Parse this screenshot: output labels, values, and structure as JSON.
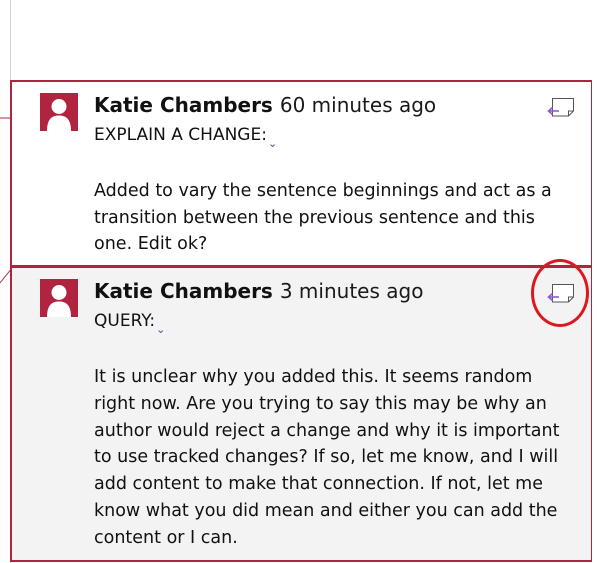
{
  "comments": [
    {
      "author": "Katie Chambers",
      "time": "60 minutes ago",
      "tag": "EXPLAIN A CHANGE:",
      "body": "Added to vary the sentence beginnings and act as a transition between the previous sentence and this one. Edit ok?",
      "reply_icon": "reply-note-icon"
    },
    {
      "author": "Katie Chambers",
      "time": "3 minutes ago",
      "tag": "QUERY:",
      "body": "It is unclear why you added this. It seems random right now. Are you trying to say this may be why an author would reject a change and why it is important to use tracked changes? If so, let me know, and I will add content to make that connection. If not, let me know what you did mean and either you can add the content or I can.",
      "reply_icon": "reply-note-icon"
    }
  ],
  "colors": {
    "accent": "#b0243f",
    "highlight": "#e0161f",
    "active_background": "#f3f3f3",
    "reply_arrow": "#8a5bd6"
  }
}
